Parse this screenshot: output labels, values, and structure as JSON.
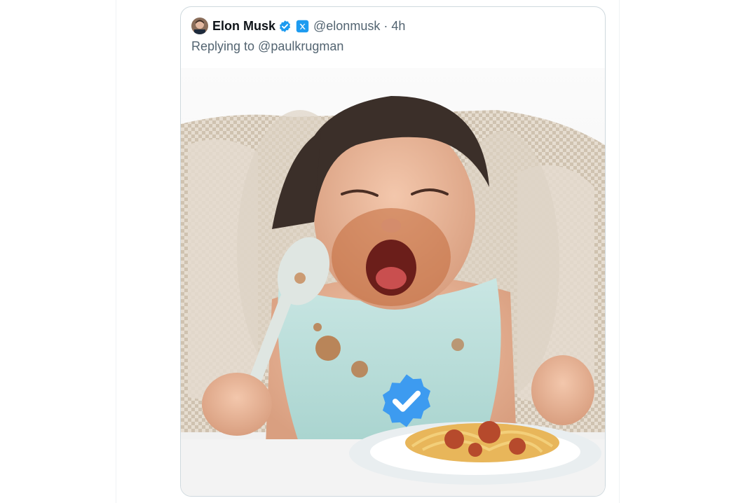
{
  "tweet": {
    "author": {
      "display_name": "Elon Musk",
      "handle": "@elonmusk",
      "time": "4h",
      "avatar_icon": "profile-avatar",
      "verified_icon": "verified-badge-icon",
      "affiliate_icon": "x-logo-badge-icon"
    },
    "separator": "·",
    "replying_to": "Replying to @paulkrugman",
    "media": {
      "description_icon": "crying-toddler-with-spaghetti-photo",
      "overlay_icon": "verified-check-badge-icon"
    }
  },
  "colors": {
    "verified_blue": "#1d9bf0",
    "text_primary": "#0f1419",
    "text_secondary": "#536471",
    "border": "#cfd9de"
  }
}
